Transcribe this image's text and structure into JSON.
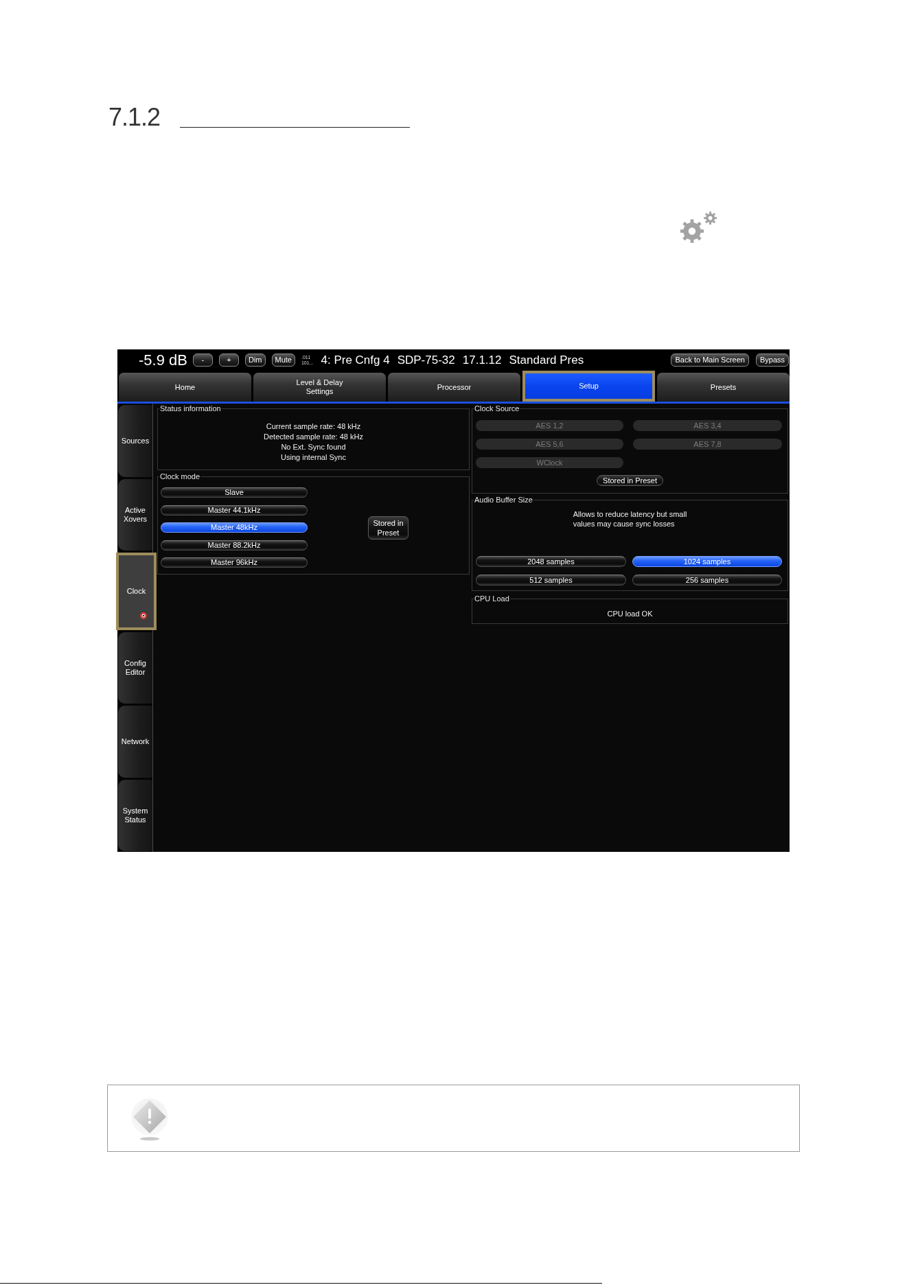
{
  "section": {
    "number": "7.1.2"
  },
  "device_screen": {
    "top_bar": {
      "volume": "-5.9 dB",
      "buttons": [
        "-",
        "+",
        "Dim",
        "Mute"
      ],
      "indicator": ".011\n101...",
      "info": [
        "4: Pre Cnfg 4",
        "SDP-75-32",
        "17.1.12",
        "Standard Pres"
      ],
      "right_buttons": [
        "Back to Main Screen",
        "Bypass"
      ]
    },
    "tabs": [
      {
        "label": "Home",
        "selected": false,
        "highlighted": false
      },
      {
        "label": "Level & Delay\nSettings",
        "selected": false,
        "highlighted": false
      },
      {
        "label": "Processor",
        "selected": false,
        "highlighted": false
      },
      {
        "label": "Setup",
        "selected": true,
        "highlighted": true
      },
      {
        "label": "Presets",
        "selected": false,
        "highlighted": false
      }
    ],
    "sidebar": {
      "items": [
        {
          "label": "Sources",
          "selected": false,
          "highlighted": false,
          "status_dot": false
        },
        {
          "label": "Active\nXovers",
          "selected": false,
          "highlighted": false,
          "status_dot": false
        },
        {
          "label": "Clock",
          "selected": true,
          "highlighted": true,
          "status_dot": true
        },
        {
          "label": "Config\nEditor",
          "selected": false,
          "highlighted": false,
          "status_dot": false
        },
        {
          "label": "Network",
          "selected": false,
          "highlighted": false,
          "status_dot": false
        },
        {
          "label": "System\nStatus",
          "selected": false,
          "highlighted": false,
          "status_dot": false
        }
      ]
    },
    "status_information": {
      "title": "Status information",
      "lines": [
        "Current sample rate: 48 kHz",
        "Detected sample rate: 48 kHz",
        "No Ext. Sync found",
        "Using internal Sync"
      ]
    },
    "clock_mode": {
      "title": "Clock mode",
      "options": [
        {
          "label": "Slave",
          "selected": false
        },
        {
          "label": "Master 44.1kHz",
          "selected": false
        },
        {
          "label": "Master 48kHz",
          "selected": true
        },
        {
          "label": "Master 88.2kHz",
          "selected": false
        },
        {
          "label": "Master 96kHz",
          "selected": false
        }
      ],
      "stored_button": "Stored in\nPreset"
    },
    "clock_source": {
      "title": "Clock Source",
      "options": [
        {
          "label": "AES 1,2",
          "disabled": true
        },
        {
          "label": "AES 3,4",
          "disabled": true
        },
        {
          "label": "AES 5,6",
          "disabled": true
        },
        {
          "label": "AES 7,8",
          "disabled": true
        },
        {
          "label": "WClock",
          "disabled": true
        }
      ],
      "stored_button": "Stored in Preset"
    },
    "audio_buffer_size": {
      "title": "Audio Buffer Size",
      "note": "Allows to reduce latency but small\nvalues may cause sync losses",
      "options": [
        {
          "label": "2048 samples",
          "selected": false
        },
        {
          "label": "1024 samples",
          "selected": true
        },
        {
          "label": "512 samples",
          "selected": false
        },
        {
          "label": "256 samples",
          "selected": false
        }
      ]
    },
    "cpu_load": {
      "title": "CPU Load",
      "status": "CPU load OK"
    }
  }
}
